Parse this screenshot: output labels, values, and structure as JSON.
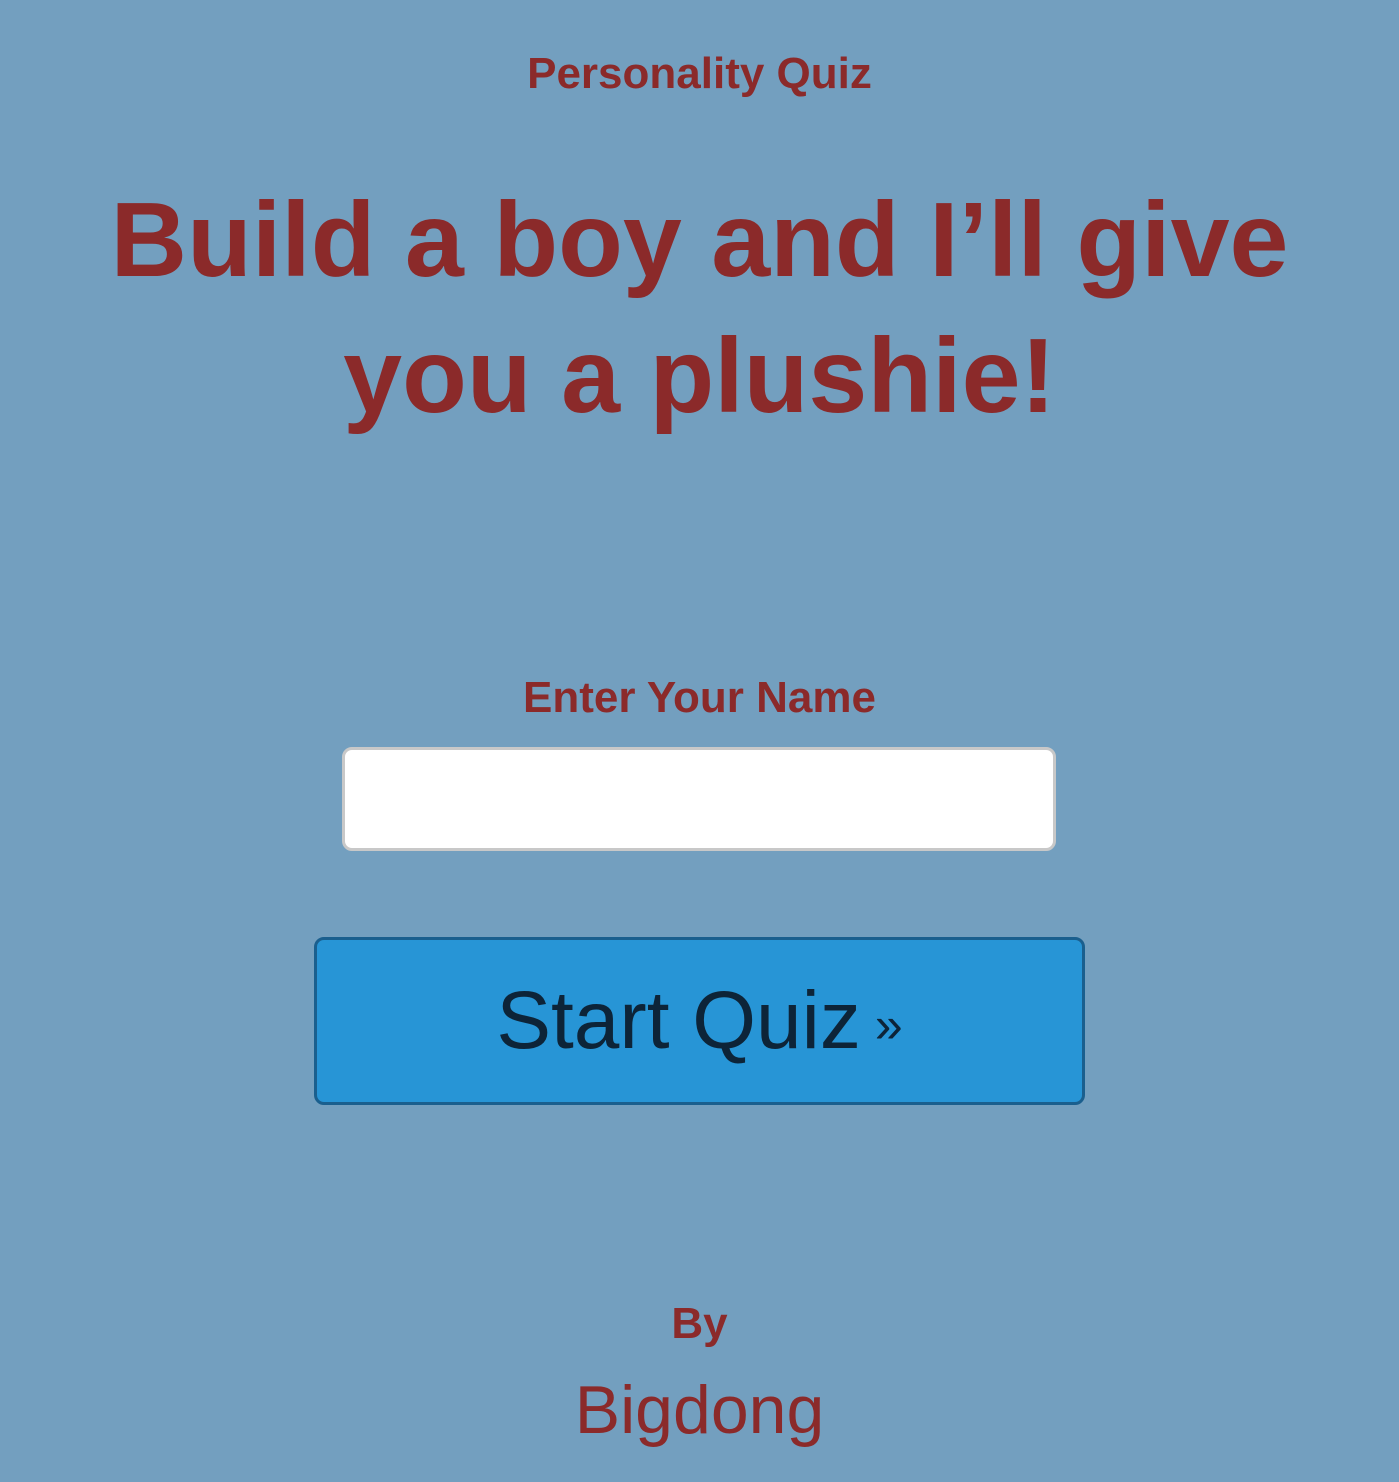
{
  "header": {
    "quiz_type": "Personality Quiz",
    "title": "Build a boy and I’ll give you a plushie!"
  },
  "form": {
    "name_label": "Enter Your Name",
    "name_value": "",
    "name_placeholder": "",
    "start_label": "Start Quiz",
    "start_arrows": "»"
  },
  "footer": {
    "by_label": "By",
    "author": "Bigdong"
  },
  "colors": {
    "background": "#739fbf",
    "text_accent": "#8b2a2a",
    "button": "#2795d6",
    "button_text": "#0d2438"
  }
}
